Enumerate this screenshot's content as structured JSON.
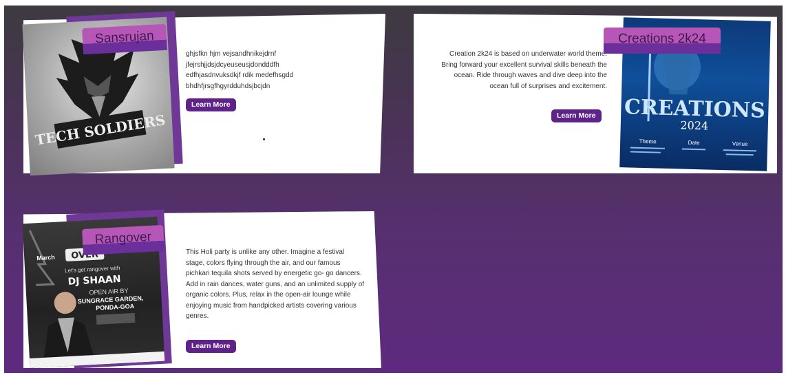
{
  "cards": [
    {
      "tag": "Sansrujan",
      "description": "ghjsfkn hjm vejsandhnikejdrnf jfejrshjjdsjdcyeuseusjdondddfh edfhjasdnvuksdkjf rdik medefhsgdd bhdhfjrsgfhgyrdduhdsjbcjdn",
      "button": "Learn More",
      "logo_text": "TECH SOLDIERS"
    },
    {
      "tag": "Creations 2k24",
      "description": "Creation 2k24 is based on underwater world theme. Bring forward your excellent survival skills beneath the ocean. Ride through waves and dive deep into the ocean full of surprises and excitement.",
      "button": "Learn More",
      "poster": {
        "title_main": "CREATIONS",
        "title_year": "2024",
        "col1_head": "Theme",
        "col2_head": "Date",
        "col3_head": "Venue"
      }
    },
    {
      "tag": "Rangover",
      "description": "This Holi party is unlike any other. Imagine a festival stage, colors flying through the air, and our famous pichkari tequila shots served by energetic go- go dancers. Add in rain dances, water guns, and an unlimited supply of organic colors. Plus, relax in the open-air lounge while enjoying music from handpicked artists covering various genres.",
      "button": "Learn More",
      "poster": {
        "date_month": "March",
        "brand": "OVER",
        "line1": "Let's get rangover with",
        "dj": "DJ SHAAN",
        "line2": "OPEN AIR BY",
        "venue1": "SUNGRACE GARDEN,",
        "venue2": "PONDA-GOA"
      }
    }
  ],
  "colors": {
    "accent": "#5f2289",
    "tag_top": "#b657b8",
    "tag_bottom": "#6a2f9a",
    "bg_top": "#3d3a40",
    "bg_bottom": "#5e2a80"
  }
}
